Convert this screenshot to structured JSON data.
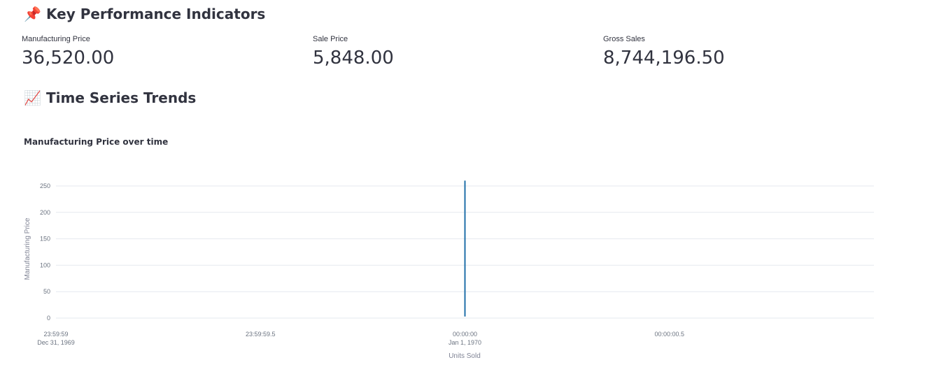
{
  "kpi": {
    "icon": "pushpin-icon",
    "emoji": "📌",
    "title": "Key Performance Indicators",
    "metrics": [
      {
        "label": "Manufacturing Price",
        "value": "36,520.00"
      },
      {
        "label": "Sale Price",
        "value": "5,848.00"
      },
      {
        "label": "Gross Sales",
        "value": "8,744,196.50"
      }
    ]
  },
  "timeseries": {
    "icon": "chart-increasing-icon",
    "emoji": "📈",
    "title": "Time Series Trends"
  },
  "chart_data": {
    "type": "line",
    "title": "Manufacturing Price over time",
    "xlabel": "Units Sold",
    "ylabel": "Manufacturing Price",
    "ylim": [
      0,
      260
    ],
    "yticks": [
      "0",
      "50",
      "100",
      "150",
      "200",
      "250"
    ],
    "xticks": [
      {
        "line1": "23:59:59",
        "line2": "Dec 31, 1969"
      },
      {
        "line1": "23:59:59.5",
        "line2": ""
      },
      {
        "line1": "00:00:00",
        "line2": "Jan 1, 1970"
      },
      {
        "line1": "00:00:00.5",
        "line2": ""
      }
    ],
    "series": [
      {
        "values": [
          {
            "x": "1970-01-01T00:00:00",
            "y": 3
          },
          {
            "x": "1970-01-01T00:00:00",
            "y": 260
          }
        ]
      }
    ],
    "line_color": "#1f6fa8",
    "grid": true
  }
}
